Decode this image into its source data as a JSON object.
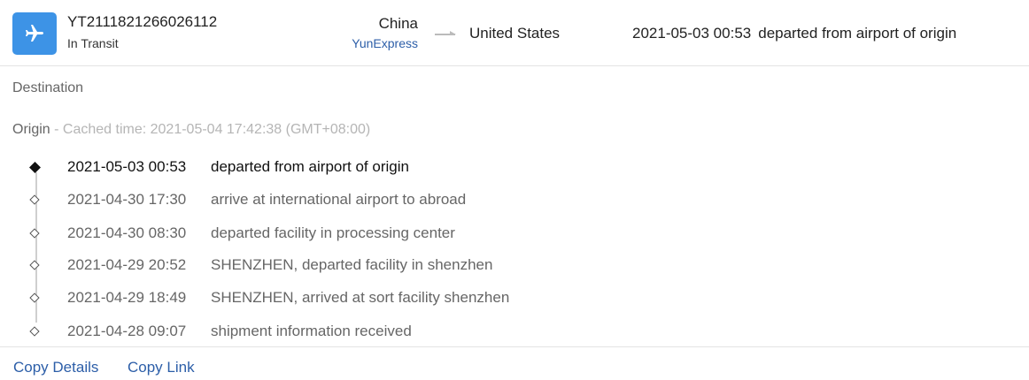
{
  "shipment": {
    "tracking_number": "YT2111821266026112",
    "status": "In Transit",
    "origin_country": "China",
    "carrier": "YunExpress",
    "destination_country": "United States",
    "latest_time": "2021-05-03 00:53",
    "latest_description": "departed from airport of origin"
  },
  "icons": {
    "plane": "airplane-icon",
    "route": "arrow-right-icon",
    "current_marker": "filled-diamond-icon",
    "past_marker": "hollow-diamond-icon"
  },
  "sections": {
    "destination_label": "Destination",
    "origin_label": "Origin",
    "cached_text": " - Cached time: 2021-05-04 17:42:38 (GMT+08:00)"
  },
  "events": [
    {
      "time": "2021-05-03 00:53",
      "description": "departed from airport of origin"
    },
    {
      "time": "2021-04-30 17:30",
      "description": "arrive at international airport to abroad"
    },
    {
      "time": "2021-04-30 08:30",
      "description": "departed facility in processing center"
    },
    {
      "time": "2021-04-29 20:52",
      "description": "SHENZHEN, departed facility in shenzhen"
    },
    {
      "time": "2021-04-29 18:49",
      "description": "SHENZHEN, arrived at sort facility shenzhen"
    },
    {
      "time": "2021-04-28 09:07",
      "description": "shipment information received"
    }
  ],
  "actions": {
    "copy_details": "Copy Details",
    "copy_link": "Copy Link"
  },
  "colors": {
    "accent": "#3d93e6",
    "link": "#2c5ea8"
  }
}
